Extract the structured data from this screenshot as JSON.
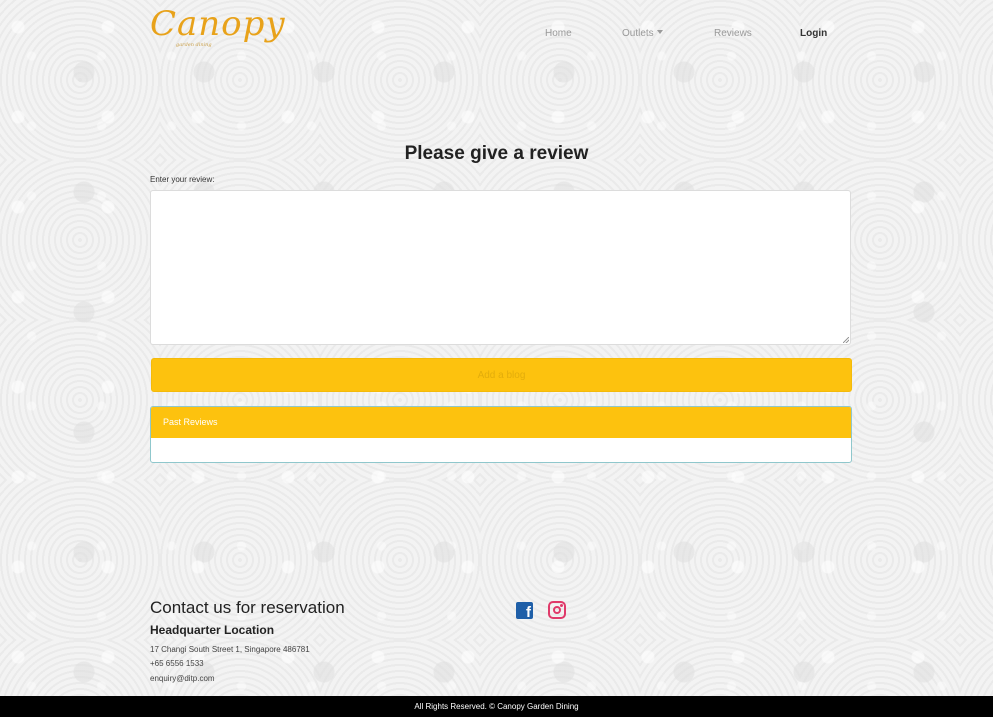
{
  "navbar": {
    "logo_text": "Canopy",
    "logo_sub": "garden dining",
    "items": [
      {
        "label": "Home"
      },
      {
        "label": "Outlets"
      },
      {
        "label": "Reviews"
      },
      {
        "label": "Login"
      }
    ]
  },
  "main": {
    "title": "Please give a review",
    "review_label": "Enter your review:",
    "review_value": "",
    "add_button_label": "Add a blog",
    "past_reviews_header": "Past Reviews"
  },
  "footer": {
    "contact_title": "Contact us for reservation",
    "hq_title": "Headquarter Location",
    "address": "17 Changi South Street 1, Singapore 486781",
    "phone": "+65 6556 1533",
    "email": "enquiry@ditp.com",
    "social_icons": [
      "facebook-icon",
      "instagram-icon"
    ],
    "copyright": "All Rights Reserved. © Canopy Garden Dining"
  },
  "colors": {
    "accent": "#fdc20e",
    "logo": "#e8a21a",
    "facebook": "#1f5fa8",
    "instagram": "#e03a6a",
    "bottom_bar": "#000000"
  }
}
